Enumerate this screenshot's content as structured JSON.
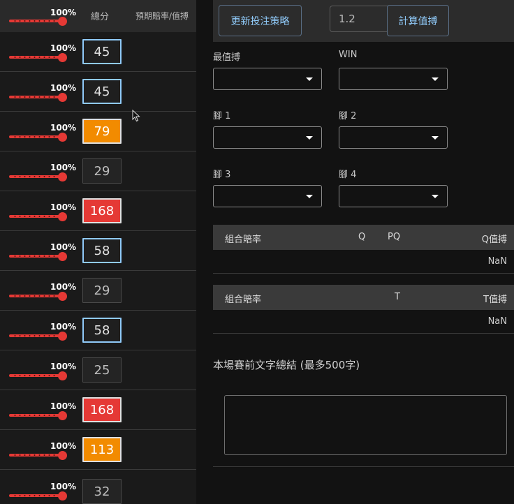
{
  "left_panel": {
    "header": {
      "score_label": "總分",
      "odds_label": "預期賠率/值搏",
      "percent": "100%"
    },
    "rows": [
      {
        "percent": "100%",
        "score": "45"
      },
      {
        "percent": "100%",
        "score": "45"
      },
      {
        "percent": "100%",
        "score": "79"
      },
      {
        "percent": "100%",
        "score": "29"
      },
      {
        "percent": "100%",
        "score": "168"
      },
      {
        "percent": "100%",
        "score": "58"
      },
      {
        "percent": "100%",
        "score": "29"
      },
      {
        "percent": "100%",
        "score": "58"
      },
      {
        "percent": "100%",
        "score": "25"
      },
      {
        "percent": "100%",
        "score": "168"
      },
      {
        "percent": "100%",
        "score": "113"
      },
      {
        "percent": "100%",
        "score": "32"
      }
    ]
  },
  "toolbar": {
    "update_strategy_label": "更新投注策略",
    "multiplier_value": "1.2",
    "calculate_label": "計算值搏"
  },
  "selectors": {
    "best_value_label": "最值搏",
    "win_label": "WIN",
    "leg1_label": "腳 1",
    "leg2_label": "腳 2",
    "leg3_label": "腳 3",
    "leg4_label": "腳 4"
  },
  "q_table": {
    "headers": {
      "combo": "組合賠率",
      "q": "Q",
      "pq": "PQ",
      "value": "Q值搏"
    },
    "value": "NaN"
  },
  "t_table": {
    "headers": {
      "combo": "組合賠率",
      "t": "T",
      "value": "T值搏"
    },
    "value": "NaN"
  },
  "summary": {
    "title": "本場賽前文字總結 (最多500字)",
    "text": ""
  },
  "colors": {
    "accent_blue": "#90caf9",
    "slider_red": "#e53935",
    "score_orange": "#f28b00",
    "score_red": "#e53935"
  }
}
